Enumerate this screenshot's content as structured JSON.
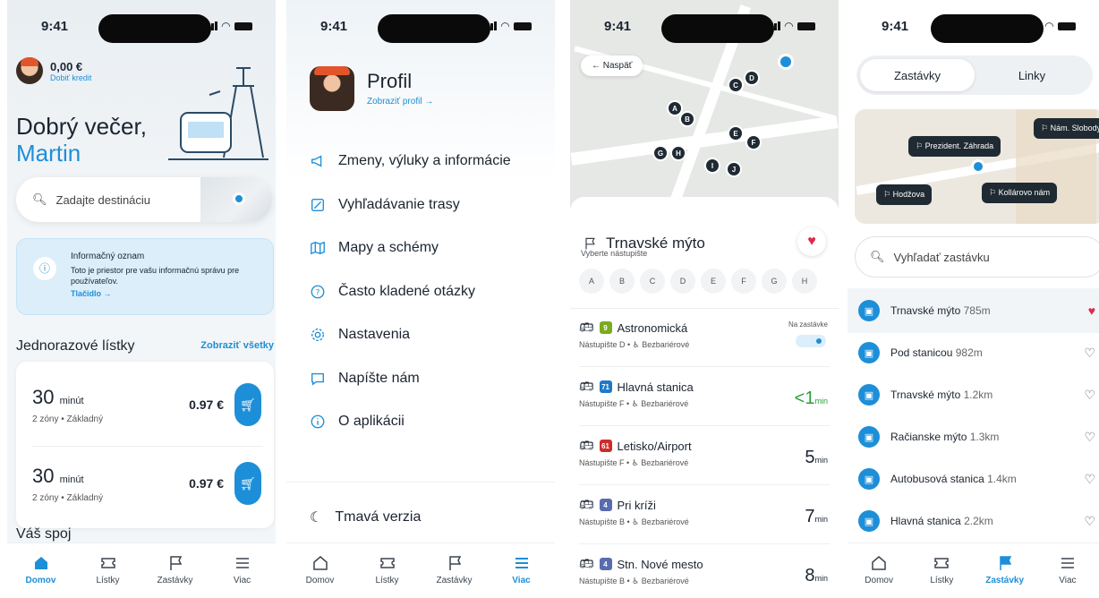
{
  "status_time": "9:41",
  "tabs": [
    {
      "label": "Domov"
    },
    {
      "label": "Lístky"
    },
    {
      "label": "Zastávky"
    },
    {
      "label": "Viac"
    }
  ],
  "s1": {
    "balance": "0,00 €",
    "topup": "Dobiť kredit",
    "greeting": "Dobrý večer,",
    "name": "Martin",
    "search_placeholder": "Zadajte destináciu",
    "notice": {
      "title": "Informačný oznam",
      "body": "Toto je priestor pre vašu informačnú správu pre používateľov.",
      "button": "Tlačidlo →"
    },
    "tickets_title": "Jednorazové lístky",
    "show_all": "Zobraziť všetky",
    "tickets": [
      {
        "duration": "30",
        "unit": "minút",
        "desc": "2 zóny • Základný",
        "price": "0.97 €"
      },
      {
        "duration": "30",
        "unit": "minút",
        "desc": "2 zóny • Základný",
        "price": "0.97 €"
      }
    ],
    "your_trip": "Váš spoj"
  },
  "s2": {
    "title": "Profil",
    "view_profile": "Zobraziť profil →",
    "menu": [
      {
        "label": "Zmeny, výluky a informácie",
        "icon": "megaphone-icon"
      },
      {
        "label": "Vyhľadávanie trasy",
        "icon": "route-icon"
      },
      {
        "label": "Mapy a schémy",
        "icon": "map-icon"
      },
      {
        "label": "Často kladené otázky",
        "icon": "question-icon"
      },
      {
        "label": "Nastavenia",
        "icon": "gear-icon"
      },
      {
        "label": "Napíšte nám",
        "icon": "chat-icon"
      },
      {
        "label": "O aplikácii",
        "icon": "info-icon"
      }
    ],
    "dark_mode": "Tmavá verzia"
  },
  "s3": {
    "back": "← Naspäť",
    "stop": "Trnavské mýto",
    "choose_platform": "Vyberte nástupište",
    "platforms": [
      "A",
      "B",
      "C",
      "D",
      "E",
      "F",
      "G",
      "H"
    ],
    "departures": [
      {
        "line": "9",
        "color": "#7bab1e",
        "dest": "Astronomická",
        "sub": "Nástupište D • ♿ Bezbariérové",
        "eta": "",
        "unit": "",
        "at_stop": "Na zastávke"
      },
      {
        "line": "71",
        "color": "#1f78c8",
        "dest": "Hlavná stanica",
        "sub": "Nástupište F • ♿ Bezbariérové",
        "eta": "<1",
        "unit": "min"
      },
      {
        "line": "61",
        "color": "#d02a2a",
        "dest": "Letisko/Airport",
        "sub": "Nástupište F • ♿ Bezbariérové",
        "eta": "5",
        "unit": "min"
      },
      {
        "line": "4",
        "color": "#5a6bb0",
        "dest": "Pri kríži",
        "sub": "Nástupište B • ♿ Bezbariérové",
        "eta": "7",
        "unit": "min"
      },
      {
        "line": "4",
        "color": "#5a6bb0",
        "dest": "Stn. Nové mesto",
        "sub": "Nástupište B • ♿ Bezbariérové",
        "eta": "8",
        "unit": "min"
      }
    ]
  },
  "s4": {
    "seg": [
      "Zastávky",
      "Linky"
    ],
    "flags": [
      "Prezident. Záhrada",
      "Nám. Slobody",
      "Hodžova",
      "Kollárovo nám"
    ],
    "search_placeholder": "Vyhľadať zastávku",
    "stops": [
      {
        "name": "Trnavské mýto",
        "dist": "785m",
        "fav": true
      },
      {
        "name": "Pod stanicou",
        "dist": "982m",
        "fav": false
      },
      {
        "name": "Trnavské mýto",
        "dist": "1.2km",
        "fav": false
      },
      {
        "name": "Račianske mýto",
        "dist": "1.3km",
        "fav": false
      },
      {
        "name": "Autobusová stanica",
        "dist": "1.4km",
        "fav": false
      },
      {
        "name": "Hlavná stanica",
        "dist": "2.2km",
        "fav": false
      }
    ]
  }
}
